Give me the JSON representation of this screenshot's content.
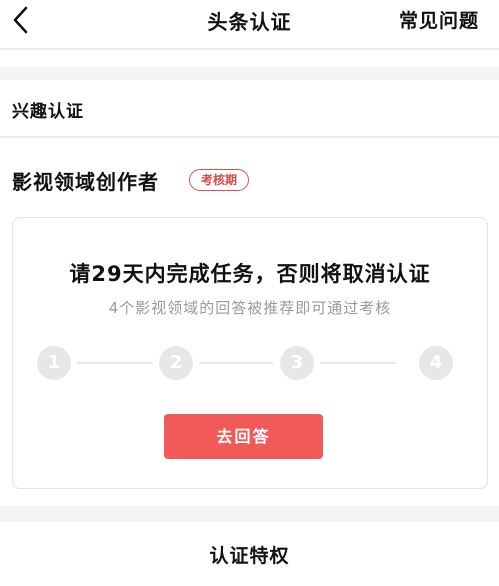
{
  "navbar": {
    "title": "头条认证",
    "faq_label": "常见问题",
    "back_icon": "chevron-left-icon"
  },
  "section": {
    "label": "兴趣认证"
  },
  "role": {
    "title": "影视领域创作者",
    "badge": "考核期",
    "badge_color": "#e25050"
  },
  "task": {
    "title": "请29天内完成任务，否则将取消认证",
    "subtitle": "4个影视领域的回答被推荐即可通过考核",
    "steps": [
      "1",
      "2",
      "3",
      "4"
    ],
    "completed_steps": 0,
    "button_label": "去回答",
    "button_color": "#f25a5a"
  },
  "footer": {
    "privilege_title": "认证特权"
  }
}
